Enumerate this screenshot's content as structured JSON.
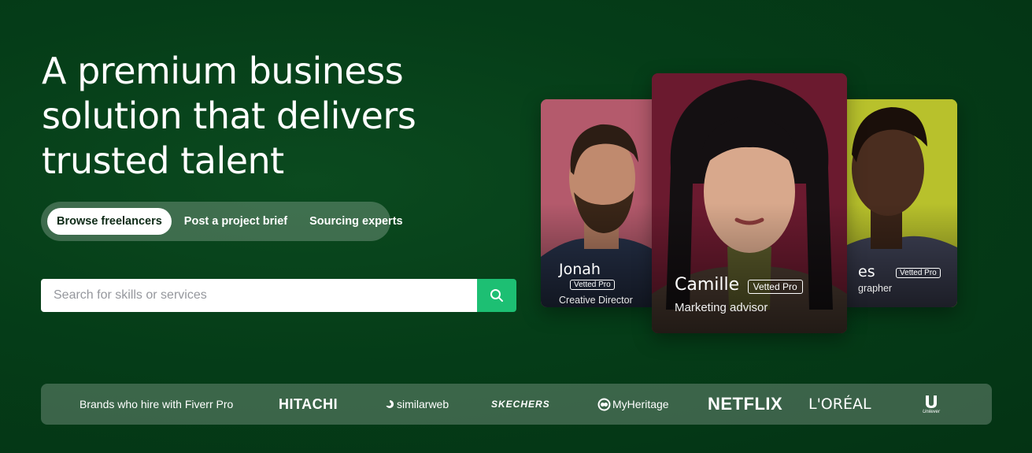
{
  "hero": {
    "headline_line1": "A premium business",
    "headline_line2": "solution that delivers",
    "headline_line3": "trusted talent"
  },
  "tabs": [
    {
      "label": "Browse freelancers",
      "active": true
    },
    {
      "label": "Post a project brief",
      "active": false
    },
    {
      "label": "Sourcing experts",
      "active": false
    }
  ],
  "search": {
    "placeholder": "Search for skills or services",
    "button_icon": "search-icon",
    "button_color": "#1dbf73"
  },
  "cards": {
    "left": {
      "name": "Jonah",
      "badge": "Vetted Pro",
      "role": "Creative Director"
    },
    "center": {
      "name": "Camille",
      "badge": "Vetted Pro",
      "role": "Marketing advisor"
    },
    "right": {
      "name": "es",
      "badge": "Vetted Pro",
      "role": "grapher"
    }
  },
  "brands": {
    "label": "Brands who hire with Fiverr Pro",
    "logos": [
      "HITACHI",
      "similarweb",
      "SKECHERS",
      "MyHeritage",
      "NETFLIX",
      "L'ORÉAL",
      "Unilever"
    ]
  }
}
